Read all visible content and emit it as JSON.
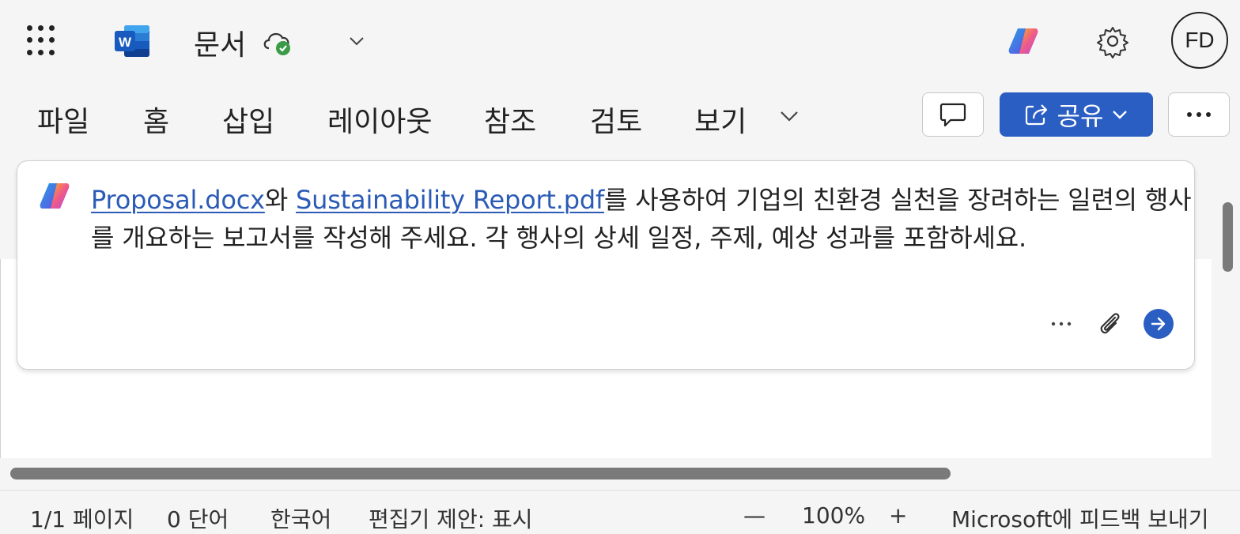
{
  "app": {
    "document_title": "문서",
    "user_initials": "FD"
  },
  "ribbon": {
    "tabs": [
      "파일",
      "홈",
      "삽입",
      "레이아웃",
      "참조",
      "검토",
      "보기"
    ],
    "share_label": "공유"
  },
  "prompt": {
    "link1": "Proposal.docx",
    "text1": "와 ",
    "link2": "Sustainability Report.pdf",
    "text2": "를 사용하여 기업의 친환경 실천을 장려하는 일련의 행사를 개요하는 보고서를 작성해 주세요. 각 행사의 상세 일정, 주제, 예상 성과를 포함하세요."
  },
  "status": {
    "page": "1/1 페이지",
    "words": "0 단어",
    "language": "한국어",
    "editor": "편집기 제안: 표시",
    "zoom_out": "—",
    "zoom": "100%",
    "zoom_in": "+",
    "feedback": "Microsoft에 피드백 보내기"
  },
  "colors": {
    "accent": "#2b5ec2",
    "link": "#2b5bb5",
    "cloud_check": "#3a9b47"
  },
  "icons": [
    "app-launcher-icon",
    "word-logo-icon",
    "cloud-saved-icon",
    "chevron-down-icon",
    "copilot-icon",
    "gear-icon",
    "comment-icon",
    "share-icon",
    "more-icon",
    "attach-icon",
    "send-icon"
  ]
}
